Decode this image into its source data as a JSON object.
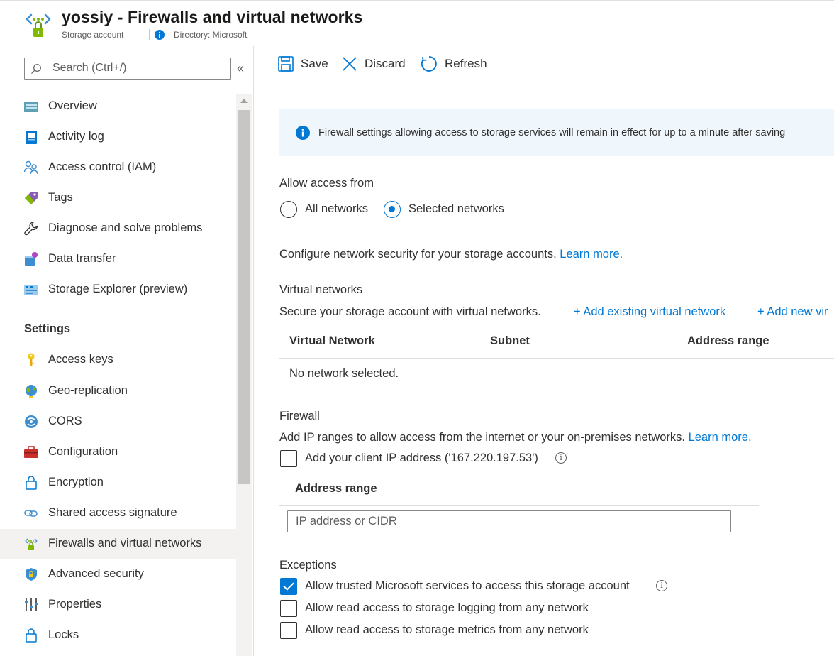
{
  "header": {
    "title": "yossiy - Firewalls and virtual networks",
    "subtitle": "Storage account",
    "directory": "Directory: Microsoft"
  },
  "sidebar": {
    "search_placeholder": "Search (Ctrl+/)",
    "collapse_glyph": "«",
    "items": [
      {
        "label": "Overview",
        "icon": "overview-icon"
      },
      {
        "label": "Activity log",
        "icon": "activity-log-icon"
      },
      {
        "label": "Access control (IAM)",
        "icon": "iam-icon"
      },
      {
        "label": "Tags",
        "icon": "tag-icon"
      },
      {
        "label": "Diagnose and solve problems",
        "icon": "wrench-icon"
      },
      {
        "label": "Data transfer",
        "icon": "data-transfer-icon"
      },
      {
        "label": "Storage Explorer (preview)",
        "icon": "storage-explorer-icon"
      }
    ],
    "settings_title": "Settings",
    "settings_items": [
      {
        "label": "Access keys",
        "icon": "key-icon"
      },
      {
        "label": "Geo-replication",
        "icon": "globe-icon"
      },
      {
        "label": "CORS",
        "icon": "cors-icon"
      },
      {
        "label": "Configuration",
        "icon": "toolbox-icon"
      },
      {
        "label": "Encryption",
        "icon": "lock-icon"
      },
      {
        "label": "Shared access signature",
        "icon": "link-icon"
      },
      {
        "label": "Firewalls and virtual networks",
        "icon": "firewall-icon",
        "active": true
      },
      {
        "label": "Advanced security",
        "icon": "shield-icon"
      },
      {
        "label": "Properties",
        "icon": "properties-icon"
      },
      {
        "label": "Locks",
        "icon": "lock-icon"
      }
    ]
  },
  "toolbar": {
    "save": "Save",
    "discard": "Discard",
    "refresh": "Refresh"
  },
  "main": {
    "info_text": "Firewall settings allowing access to storage services will remain in effect for up to a minute after saving",
    "allow_access_from": "Allow access from",
    "radio_all": "All networks",
    "radio_selected": "Selected networks",
    "selected_option": "Selected networks",
    "configure_text": "Configure network security for your storage accounts.",
    "learn_more": "Learn more.",
    "vnet_title": "Virtual networks",
    "vnet_desc": "Secure your storage account with virtual networks.",
    "add_existing": "+ Add existing virtual network",
    "add_new": "+ Add new vir",
    "vnet_columns": [
      "Virtual Network",
      "Subnet",
      "Address range"
    ],
    "vnet_empty": "No network selected.",
    "firewall_title": "Firewall",
    "firewall_desc": "Add IP ranges to allow access from the internet or your on-premises networks.",
    "firewall_learn_more": "Learn more.",
    "client_ip_label": "Add your client IP address ('167.220.197.53')",
    "address_range_header": "Address range",
    "ip_placeholder": "IP address or CIDR",
    "exceptions_title": "Exceptions",
    "exceptions": [
      {
        "label": "Allow trusted Microsoft services to access this storage account",
        "checked": true,
        "info": true
      },
      {
        "label": "Allow read access to storage logging from any network",
        "checked": false
      },
      {
        "label": "Allow read access to storage metrics from any network",
        "checked": false
      }
    ]
  },
  "colors": {
    "accent": "#0078d4",
    "active_bg": "#f3f2f1",
    "info_bg": "#eff6fc"
  }
}
